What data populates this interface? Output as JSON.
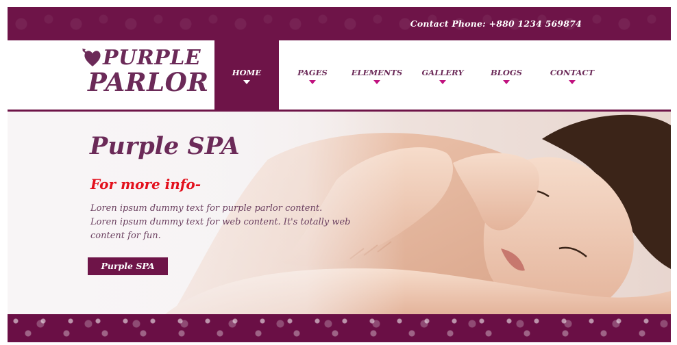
{
  "topbar": {
    "phone": "Contact Phone: +880 1234 569874"
  },
  "logo": {
    "line1": "PURPLE",
    "line2": "PARLOR",
    "icon": "heart-arrow-icon"
  },
  "nav": [
    {
      "label": "HOME",
      "active": true
    },
    {
      "label": "PAGES",
      "active": false
    },
    {
      "label": "ELEMENTS",
      "active": false
    },
    {
      "label": "GALLERY",
      "active": false
    },
    {
      "label": "BLOGS",
      "active": false
    },
    {
      "label": "CONTACT",
      "active": false
    }
  ],
  "hero": {
    "title": "Purple SPA",
    "subtitle": "For more info-",
    "body": "Loren ipsum dummy text for purple parlor content. Loren ipsum dummy text for web content. It's totally web content for fun.",
    "button": "Purple SPA"
  },
  "colors": {
    "brand": "#6e1448",
    "text": "#6b2a58",
    "accent_red": "#e3101c",
    "nav_marker": "#c0127f"
  }
}
